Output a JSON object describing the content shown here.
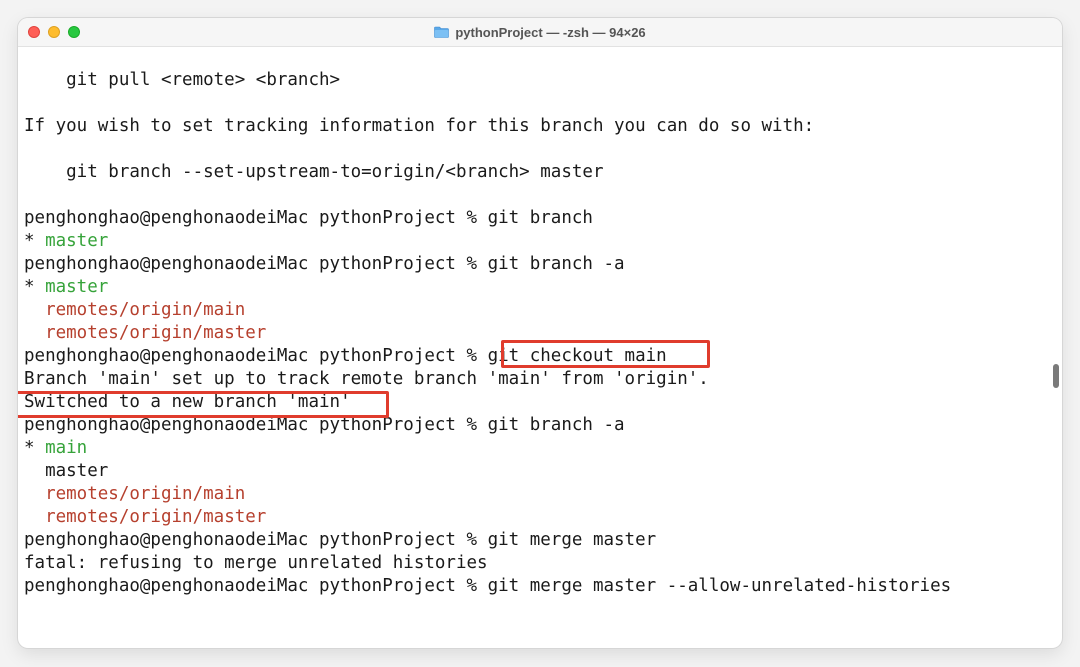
{
  "window": {
    "title": "pythonProject — -zsh — 94×26",
    "folder_icon": "folder-icon"
  },
  "terminal": {
    "lines": [
      {
        "t": "    git pull <remote> <branch>",
        "c": "plain"
      },
      {
        "t": "",
        "c": "plain"
      },
      {
        "t": "If you wish to set tracking information for this branch you can do so with:",
        "c": "plain"
      },
      {
        "t": "",
        "c": "plain"
      },
      {
        "t": "    git branch --set-upstream-to=origin/<branch> master",
        "c": "plain"
      },
      {
        "t": "",
        "c": "plain"
      },
      {
        "t": "penghonghao@penghonaodeiMac pythonProject % git branch",
        "c": "plain"
      },
      {
        "prefix": "* ",
        "t": "master",
        "c": "green"
      },
      {
        "t": "penghonghao@penghonaodeiMac pythonProject % git branch -a",
        "c": "plain"
      },
      {
        "prefix": "* ",
        "t": "master",
        "c": "green"
      },
      {
        "prefix": "  ",
        "t": "remotes/origin/main",
        "c": "red"
      },
      {
        "prefix": "  ",
        "t": "remotes/origin/master",
        "c": "red"
      },
      {
        "t": "penghonghao@penghonaodeiMac pythonProject % git checkout main",
        "c": "plain"
      },
      {
        "t": "Branch 'main' set up to track remote branch 'main' from 'origin'.",
        "c": "plain"
      },
      {
        "t": "Switched to a new branch 'main'",
        "c": "plain"
      },
      {
        "t": "penghonghao@penghonaodeiMac pythonProject % git branch -a",
        "c": "plain"
      },
      {
        "prefix": "* ",
        "t": "main",
        "c": "green"
      },
      {
        "prefix": "  ",
        "t": "master",
        "c": "plain"
      },
      {
        "prefix": "  ",
        "t": "remotes/origin/main",
        "c": "red"
      },
      {
        "prefix": "  ",
        "t": "remotes/origin/master",
        "c": "red"
      },
      {
        "t": "penghonghao@penghonaodeiMac pythonProject % git merge master",
        "c": "plain"
      },
      {
        "t": "fatal: refusing to merge unrelated histories",
        "c": "plain"
      },
      {
        "t": "penghonghao@penghonaodeiMac pythonProject % git merge master --allow-unrelated-histories",
        "c": "plain"
      }
    ]
  },
  "colors": {
    "branch_current": "#36a33a",
    "branch_remote": "#b6402e",
    "highlight_box": "#e03c2d"
  }
}
